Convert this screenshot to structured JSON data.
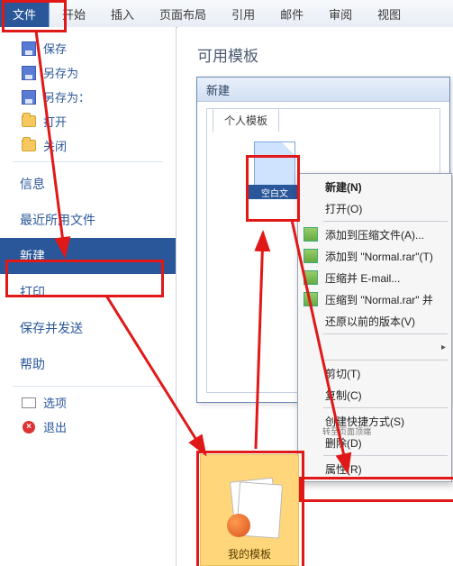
{
  "tabs": {
    "file": "文件",
    "home": "开始",
    "insert": "插入",
    "layout": "页面布局",
    "references": "引用",
    "mail": "邮件",
    "review": "审阅",
    "view": "视图"
  },
  "filemenu": {
    "save": "保存",
    "save_as": "另存为",
    "save_as_format": "另存为：",
    "open": "打开",
    "close": "关闭",
    "info": "信息",
    "recent": "最近所用文件",
    "new": "新建",
    "print": "打印",
    "save_send": "保存并发送",
    "help": "帮助",
    "options": "选项",
    "exit": "退出"
  },
  "rpane": {
    "heading": "可用模板",
    "small_caption": "转至页面顶端"
  },
  "new_window": {
    "title": "新建",
    "tab_personal": "个人模板",
    "template_label": "空白文"
  },
  "context_menu": {
    "new": "新建(N)",
    "open": "打开(O)",
    "add_to_archive": "添加到压缩文件(A)...",
    "add_to_normal": "添加到 \"Normal.rar\"(T)",
    "compress_email": "压缩并 E-mail...",
    "compress_normal": "压缩到 \"Normal.rar\" 并",
    "restore_prev": "还原以前的版本(V)",
    "cut": "剪切(T)",
    "copy": "复制(C)",
    "shortcut": "创建快捷方式(S)",
    "delete": "删除(D)",
    "properties": "属性(R)"
  },
  "tile": {
    "caption": "我的模板"
  }
}
